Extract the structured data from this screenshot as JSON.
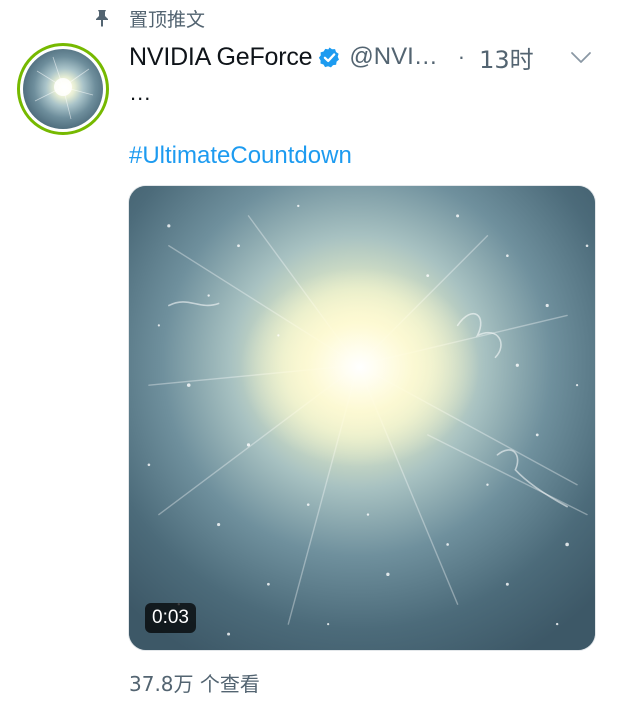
{
  "pinned": {
    "label": "置顶推文",
    "icon": "pin-icon"
  },
  "tweet": {
    "author": {
      "display_name": "NVIDIA GeForce",
      "verified": true,
      "handle": "@NVI…",
      "avatar_ring_color": "#76b900"
    },
    "separator": "·",
    "time": "13时",
    "menu_icon": "chevron-down-icon",
    "text_ellipsis": "...",
    "hashtag": "#UltimateCountdown",
    "media": {
      "type": "video",
      "duration": "0:03"
    },
    "views": "37.8万 个查看"
  },
  "colors": {
    "text_primary": "#0f1419",
    "text_secondary": "#536471",
    "link": "#1d9bf0",
    "verified": "#1d9bf0"
  }
}
